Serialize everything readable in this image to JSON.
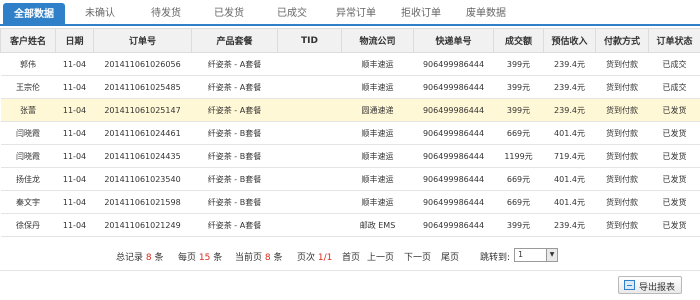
{
  "tabs": [
    "全部数据",
    "未确认",
    "待发货",
    "已发货",
    "已成交",
    "异常订单",
    "拒收订单",
    "废单数据"
  ],
  "columns": [
    "客户姓名",
    "日期",
    "订单号",
    "产品套餐",
    "TID",
    "物流公司",
    "快递单号",
    "成交额",
    "预估收入",
    "付款方式",
    "订单状态"
  ],
  "rows": [
    {
      "name": "郭伟",
      "date": "11-04",
      "order": "201411061026056",
      "package": "纤姿茶 - A套餐",
      "tid": "",
      "logistics": "顺丰速运",
      "tracking": "906499986444",
      "amount": "399元",
      "income": "239.4元",
      "payment": "货到付款",
      "status": "已成交",
      "status_type": "done",
      "highlight": false
    },
    {
      "name": "王宗伦",
      "date": "11-04",
      "order": "201411061025485",
      "package": "纤姿茶 - A套餐",
      "tid": "",
      "logistics": "顺丰速运",
      "tracking": "906499986444",
      "amount": "399元",
      "income": "239.4元",
      "payment": "货到付款",
      "status": "已成交",
      "status_type": "done",
      "highlight": false
    },
    {
      "name": "张蕾",
      "date": "11-04",
      "order": "201411061025147",
      "package": "纤姿茶 - A套餐",
      "tid": "",
      "logistics": "圆通速递",
      "tracking": "906499986444",
      "amount": "399元",
      "income": "239.4元",
      "payment": "货到付款",
      "status": "已发货",
      "status_type": "ship",
      "highlight": true
    },
    {
      "name": "闫晓霞",
      "date": "11-04",
      "order": "201411061024461",
      "package": "纤姿茶 - B套餐",
      "tid": "",
      "logistics": "顺丰速运",
      "tracking": "906499986444",
      "amount": "669元",
      "income": "401.4元",
      "payment": "货到付款",
      "status": "已发货",
      "status_type": "ship",
      "highlight": false
    },
    {
      "name": "闫晓霞",
      "date": "11-04",
      "order": "201411061024435",
      "package": "纤姿茶 - B套餐",
      "tid": "",
      "logistics": "顺丰速运",
      "tracking": "906499986444",
      "amount": "1199元",
      "income": "719.4元",
      "payment": "货到付款",
      "status": "已发货",
      "status_type": "ship",
      "highlight": false
    },
    {
      "name": "扬佳龙",
      "date": "11-04",
      "order": "201411061023540",
      "package": "纤姿茶 - B套餐",
      "tid": "",
      "logistics": "顺丰速运",
      "tracking": "906499986444",
      "amount": "669元",
      "income": "401.4元",
      "payment": "货到付款",
      "status": "已发货",
      "status_type": "ship",
      "highlight": false
    },
    {
      "name": "秦文宇",
      "date": "11-04",
      "order": "201411061021598",
      "package": "纤姿茶 - B套餐",
      "tid": "",
      "logistics": "顺丰速运",
      "tracking": "906499986444",
      "amount": "669元",
      "income": "401.4元",
      "payment": "货到付款",
      "status": "已发货",
      "status_type": "ship",
      "highlight": false
    },
    {
      "name": "徐保丹",
      "date": "11-04",
      "order": "201411061021249",
      "package": "纤姿茶 - A套餐",
      "tid": "",
      "logistics": "邮政 EMS",
      "tracking": "906499986444",
      "amount": "399元",
      "income": "239.4元",
      "payment": "货到付款",
      "status": "已发货",
      "status_type": "ship",
      "highlight": false
    }
  ],
  "pager": {
    "total_label": "总记录",
    "total": "8",
    "total_unit": "条",
    "per_page_label": "每页",
    "per_page": "15",
    "per_page_unit": "条",
    "current_label": "当前页",
    "current": "8",
    "current_unit": "条",
    "page_label": "页次",
    "page": "1/1",
    "first": "首页",
    "prev": "上一页",
    "next": "下一页",
    "last": "尾页",
    "jump_label": "跳转到:",
    "jump_value": "1"
  },
  "export_label": "导出报表",
  "colors": {
    "accent": "#2f7fc9",
    "estimate": "#d9291c",
    "status_done": "#1e5fb4",
    "status_ship": "#12821d",
    "highlight_row": "#fff8d6"
  }
}
